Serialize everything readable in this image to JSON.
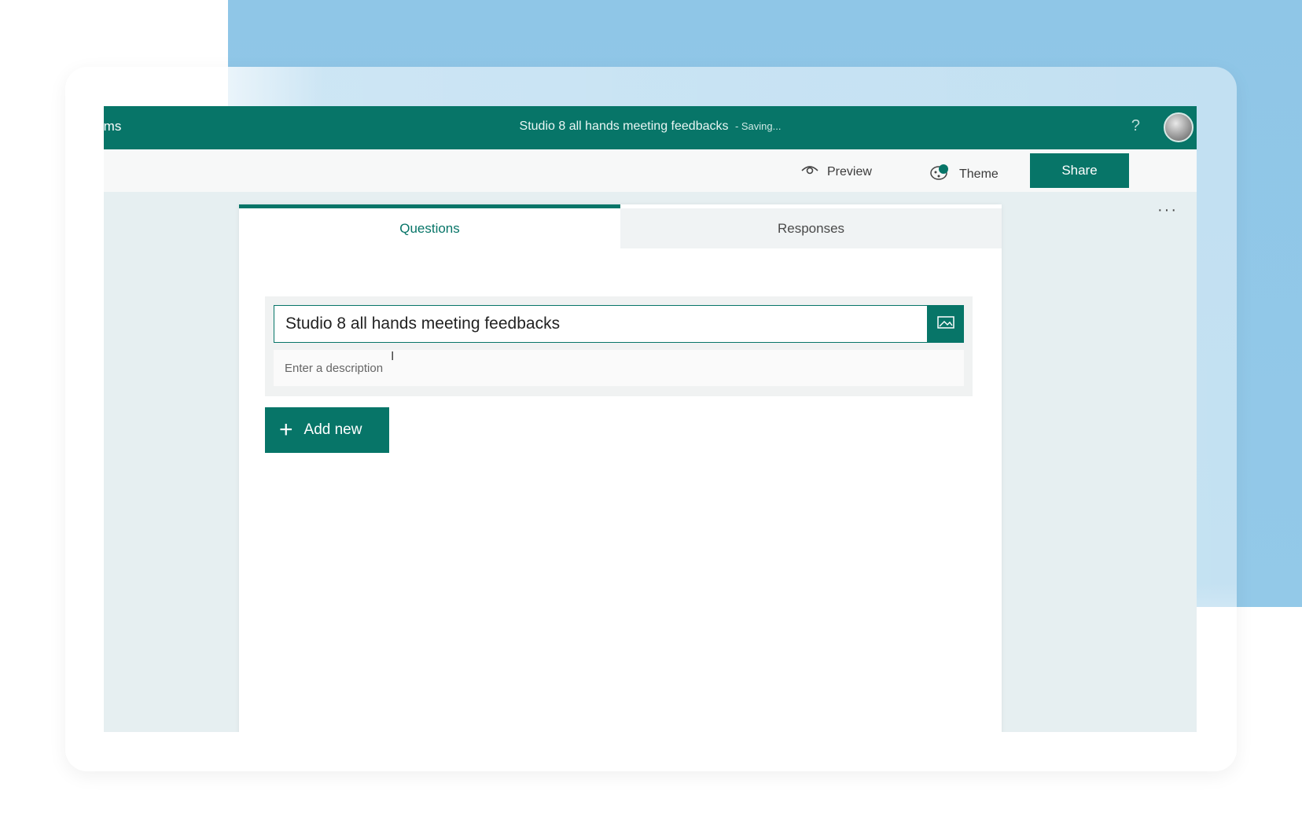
{
  "app": {
    "name": "rms"
  },
  "header": {
    "title": "Studio 8 all hands meeting feedbacks",
    "status": "- Saving...",
    "help": "?"
  },
  "toolbar": {
    "preview_label": "Preview",
    "theme_label": "Theme",
    "share_label": "Share",
    "more_label": "···"
  },
  "tabs": [
    {
      "label": "Questions",
      "active": true
    },
    {
      "label": "Responses",
      "active": false
    }
  ],
  "form": {
    "title_value": "Studio 8 all hands meeting feedbacks",
    "description_placeholder": "Enter a description"
  },
  "actions": {
    "add_new_label": "Add new"
  },
  "colors": {
    "accent": "#077568",
    "background": "#93c9e8"
  }
}
